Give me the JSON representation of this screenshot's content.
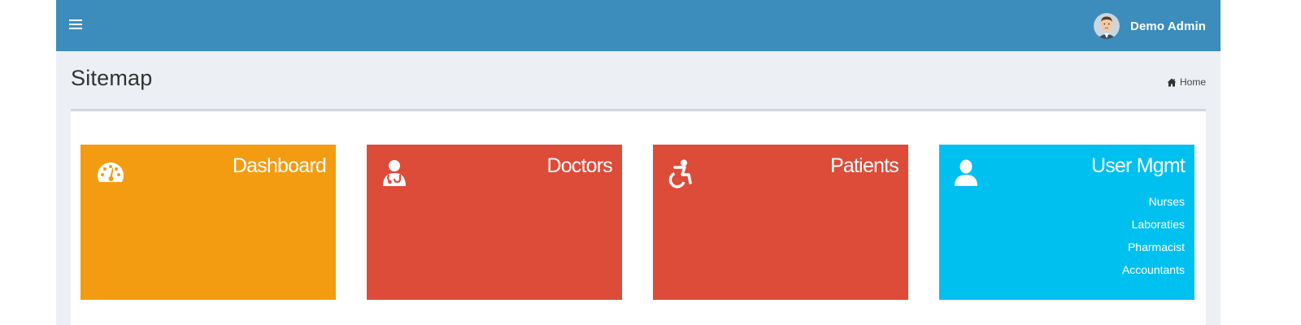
{
  "navbar": {
    "menu_icon": "hamburger-icon",
    "user_name": "Demo Admin",
    "avatar_icon": "user-avatar"
  },
  "page": {
    "title": "Sitemap",
    "breadcrumb": "Home",
    "breadcrumb_icon": "home-icon"
  },
  "tiles": [
    {
      "title": "Dashboard",
      "icon": "dashboard-icon",
      "color": "#f39c12"
    },
    {
      "title": "Doctors",
      "icon": "user-md-icon",
      "color": "#dd4b39"
    },
    {
      "title": "Patients",
      "icon": "wheelchair-icon",
      "color": "#dd4b39"
    },
    {
      "title": "User Mgmt",
      "icon": "user-icon",
      "color": "#00c0ef",
      "items": [
        "Nurses",
        "Laboraties",
        "Pharmacist",
        "Accountants"
      ]
    }
  ],
  "colors": {
    "navbar": "#3c8dbc",
    "background": "#ecf0f5",
    "box_border": "#d2d6de"
  }
}
